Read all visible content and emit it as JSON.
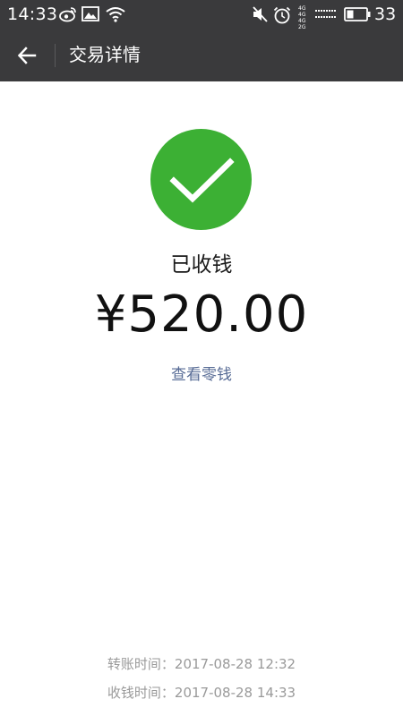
{
  "status_bar": {
    "time": "14:33",
    "network_top": "4G 4G",
    "network_bottom": "4G 2G",
    "battery_percent": "33",
    "icons": [
      "weibo-icon",
      "image-icon",
      "wifi-icon",
      "mute-icon",
      "alarm-icon",
      "signal-icon",
      "battery-icon"
    ]
  },
  "toolbar": {
    "back_icon": "arrow-left-icon",
    "title": "交易详情"
  },
  "main": {
    "status_icon": "check-circle-icon",
    "status_text": "已收钱",
    "amount": "¥520.00",
    "view_link": "查看零钱"
  },
  "info": {
    "transfer_label": "转账时间：",
    "transfer_time": "2017-08-28 12:32",
    "receive_label": "收钱时间：",
    "receive_time": "2017-08-28 14:33"
  },
  "colors": {
    "bar_background": "#3a3a3c",
    "success_green": "#3cb034",
    "link_blue": "#576b95",
    "muted_text": "#9a9a9a"
  }
}
